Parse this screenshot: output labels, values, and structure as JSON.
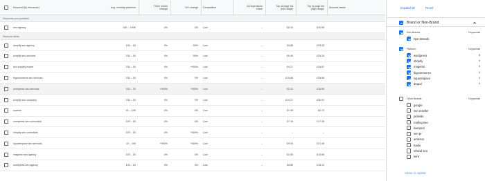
{
  "header": {
    "keyword": "Keyword (by relevance)",
    "avg_searches": "Avg. monthly searches",
    "three_month": "Three month\nchange",
    "yoy": "YoY change",
    "competition": "Competition",
    "ad_share": "Ad impression\nshare",
    "top_low": "Top of page bid\n(low range)",
    "top_high": "Top of page bid\n(high range)",
    "account_status": "Account status"
  },
  "sections": {
    "provided": "Keywords you provided",
    "ideas": "Keyword ideas"
  },
  "provided_rows": [
    {
      "keyword": "seo agency",
      "searches": "10K – 100K",
      "three_month": "0%",
      "yoy": "0%",
      "competition": "Low",
      "share": "–",
      "low": "£6.34",
      "high": "£24.58"
    }
  ],
  "idea_rows": [
    {
      "keyword": "shopify seo agency",
      "searches": "100 – 1K",
      "three_month": "0%",
      "yoy": "-90%",
      "competition": "Low",
      "share": "–",
      "low": "£5.85",
      "high": "£25.25"
    },
    {
      "keyword": "shopify seo services",
      "searches": "100 – 1K",
      "three_month": "0%",
      "yoy": "-90%",
      "competition": "Low",
      "share": "–",
      "low": "£9.40",
      "high": "£25.25"
    },
    {
      "keyword": "seo shopify expert",
      "searches": "100 – 1K",
      "three_month": "0%",
      "yoy": "+900%",
      "competition": "Low",
      "share": "–",
      "low": "£4.27",
      "high": "£34.87"
    },
    {
      "keyword": "bigcommerce seo services",
      "searches": "100 – 1K",
      "three_month": "0%",
      "yoy": "0%",
      "competition": "Low",
      "share": "–",
      "low": "£15.85",
      "high": "£35.66"
    },
    {
      "keyword": "wordpress seo services",
      "searches": "100 – 1K",
      "three_month": "+900%",
      "yoy": "+900%",
      "competition": "Low",
      "share": "–",
      "low": "£2.31",
      "high": "£16.89"
    },
    {
      "keyword": "shopify seo company",
      "searches": "100 – 1K",
      "three_month": "0%",
      "yoy": "0%",
      "competition": "Low",
      "share": "–",
      "low": "£14.27",
      "high": "£30.91"
    },
    {
      "keyword": "ewebot",
      "searches": "1K – 10K",
      "three_month": "0%",
      "yoy": "0%",
      "competition": "Low",
      "share": "–",
      "low": "£1.35",
      "high": "£6.70"
    },
    {
      "keyword": "wordpress seo consultant",
      "searches": "100 – 1K",
      "three_month": "0%",
      "yoy": "0%",
      "competition": "Low",
      "share": "–",
      "low": "£7.16",
      "high": "£17.28"
    },
    {
      "keyword": "shopify seo consultant",
      "searches": "100 – 1K",
      "three_month": "0%",
      "yoy": "+900%",
      "competition": "Low",
      "share": "–",
      "low": "–",
      "high": "–"
    },
    {
      "keyword": "squarespace seo services",
      "searches": "10 – 100",
      "three_month": "+900%",
      "yoy": "+900%",
      "competition": "Low",
      "share": "–",
      "low": "£9.04",
      "high": "£21.46"
    },
    {
      "keyword": "magento seo agency",
      "searches": "100 – 1K",
      "three_month": "0%",
      "yoy": "0%",
      "competition": "Low",
      "share": "–",
      "low": "£3.55",
      "high": "£15.85"
    },
    {
      "keyword": "wordpress seo agency",
      "searches": "100 – 1K",
      "three_month": "0%",
      "yoy": "0%",
      "competition": "Low",
      "share": "–",
      "low": "£5.89",
      "high": "£15.12"
    }
  ],
  "panel": {
    "expand_all": "Expand all",
    "reset": "Reset",
    "brand_title": "Brand or Non-Brand",
    "keywords_label": "Keywords",
    "non_brands": {
      "title": "Non-Brands",
      "items": [
        {
          "label": "Non-Brands",
          "count": "",
          "checked": true
        }
      ]
    },
    "platform": {
      "title": "Platform",
      "items": [
        {
          "label": "wordpress",
          "count": "8",
          "checked": true
        },
        {
          "label": "shopify",
          "count": "6",
          "checked": true
        },
        {
          "label": "magento",
          "count": "5",
          "checked": true
        },
        {
          "label": "bigcommerce",
          "count": "4",
          "checked": true
        },
        {
          "label": "squarespace",
          "count": "4",
          "checked": true
        },
        {
          "label": "drupal",
          "count": "3",
          "checked": true
        }
      ]
    },
    "other_brands": {
      "title": "Other Brands",
      "items": [
        {
          "label": "google",
          "checked": false
        },
        {
          "label": "seo reseller",
          "checked": false
        },
        {
          "label": "primelis",
          "checked": false
        },
        {
          "label": "roofing seo",
          "checked": false
        },
        {
          "label": "liverpool",
          "checked": false
        },
        {
          "label": "seo pr",
          "checked": false
        },
        {
          "label": "amazon",
          "checked": false
        },
        {
          "label": "baidu",
          "checked": false
        },
        {
          "label": "ethical seo",
          "checked": false
        },
        {
          "label": "kent",
          "checked": false
        }
      ]
    },
    "view_more": "VIEW 21 MORE"
  },
  "colors": {
    "accent": "#1a73e8",
    "header_bg": "#f8f9fa",
    "section_bg": "#f1f3f4"
  }
}
